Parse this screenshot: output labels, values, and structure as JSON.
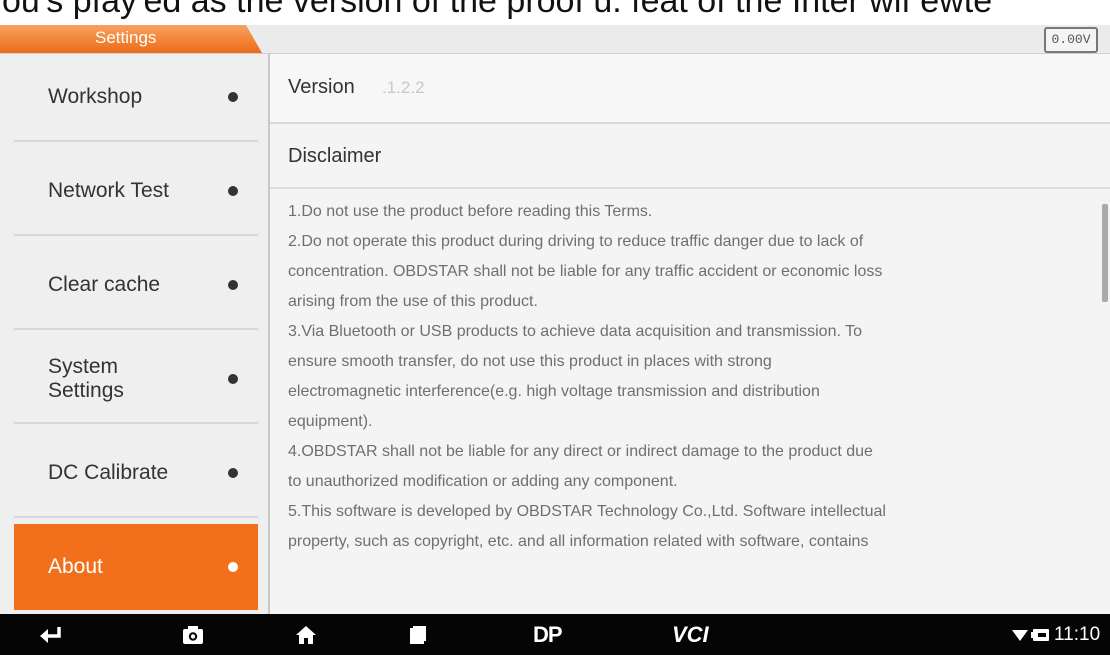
{
  "caption": "ou's pfay'ed as the version of the proof u. feat of the Inter wif ewte",
  "header": {
    "tab_label": "Settings",
    "voltage": "0.00V"
  },
  "sidebar": {
    "items": [
      {
        "label": "Workshop"
      },
      {
        "label": "Network Test"
      },
      {
        "label": "Clear cache"
      },
      {
        "label": "System Settings"
      },
      {
        "label": "DC Calibrate"
      },
      {
        "label": "About",
        "active": true
      }
    ]
  },
  "main": {
    "version_label": "Version",
    "version_value": ".1.2.2",
    "disclaimer_title": "Disclaimer",
    "disclaimer_lines": [
      "1.Do not use the product before reading this Terms.",
      "2.Do not operate this product during driving to reduce traffic danger due to lack of",
      "concentration. OBDSTAR shall not be liable for any traffic accident or economic loss",
      "arising from the use of this product.",
      "3.Via Bluetooth or USB products to achieve data acquisition and transmission. To",
      "ensure smooth transfer, do not use this product in places with strong",
      "electromagnetic interference(e.g. high voltage transmission and distribution",
      "equipment).",
      "4.OBDSTAR shall not be liable for any direct or indirect damage to the product due",
      "to unauthorized modification or adding any component.",
      "5.This software is developed by OBDSTAR Technology Co.,Ltd. Software intellectual",
      "property, such as copyright, etc. and all information related with software, contains"
    ]
  },
  "bottombar": {
    "dp_label": "DP",
    "vci_label": "VCI",
    "time": "11:10"
  },
  "icons": [
    "back-icon",
    "camera-icon",
    "home-icon",
    "recent-apps-icon",
    "wifi-icon",
    "battery-icon"
  ],
  "colors": {
    "accent": "#f26f1c",
    "sidebar_bg": "#efefef",
    "bottombar_bg": "#050505"
  }
}
